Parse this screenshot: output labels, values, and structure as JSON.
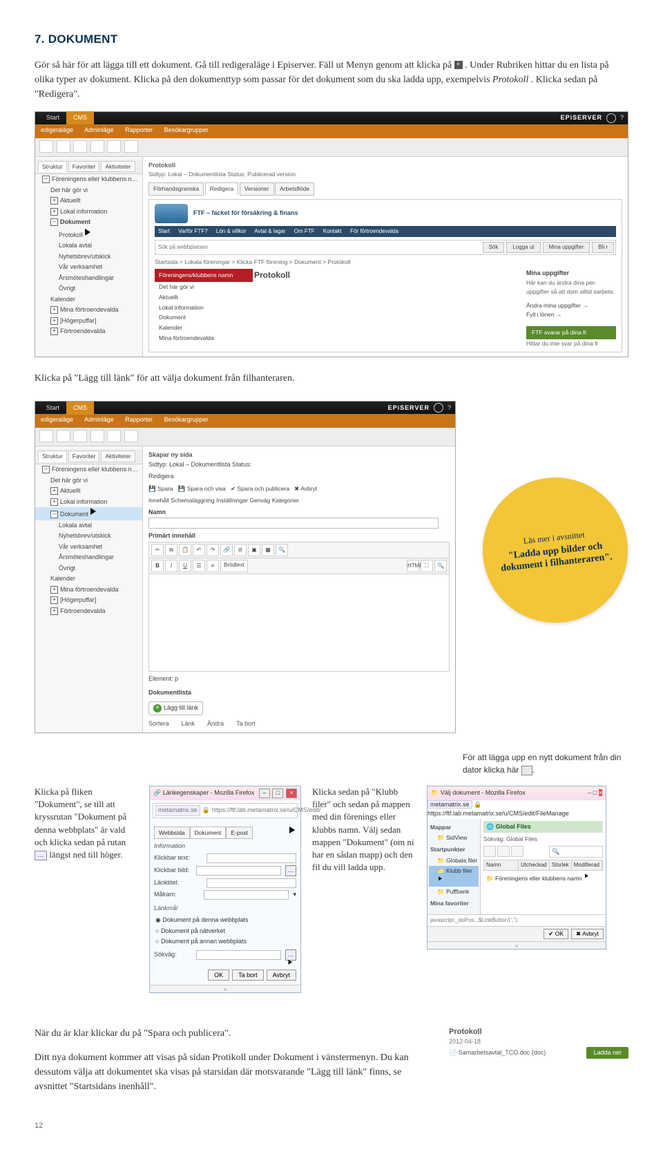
{
  "heading": "7. DOKUMENT",
  "intro": {
    "p1a": "Gör så här för att lägga till ett dokument. Gå till redigeraläge i Episerver. Fäll ut Menyn genom att klicka på ",
    "p1b": ". Under Rubriken hittar du en lista på olika typer av dokument. Klicka på den dokumenttyp som passar för det dokument som du ska ladda upp, exempelvis ",
    "p1c": "Protokoll",
    "p1d": ". Klicka sedan på \"Redigera\"."
  },
  "shot1": {
    "start": "Start",
    "cms": "CMS",
    "brand": "EPiSERVER",
    "subnav": [
      "edigeraläge",
      "Adminläge",
      "Rapporter",
      "Besökargrupper"
    ],
    "tabs": [
      "Struktur",
      "Favoriter",
      "Aktiviteter"
    ],
    "tree": [
      {
        "lv": 1,
        "t": "Föreningens eller klubbens namn"
      },
      {
        "lv": 2,
        "t": "Det här gör vi"
      },
      {
        "lv": 2,
        "t": "Aktuellt"
      },
      {
        "lv": 2,
        "t": "Lokal information"
      },
      {
        "lv": 2,
        "t": "Dokument",
        "open": true
      },
      {
        "lv": 3,
        "t": "Protokoll"
      },
      {
        "lv": 3,
        "t": "Lokala avtal"
      },
      {
        "lv": 3,
        "t": "Nyhetsbrev/utskick"
      },
      {
        "lv": 3,
        "t": "Vår verksamhet"
      },
      {
        "lv": 3,
        "t": "Årsmöteshandlingar"
      },
      {
        "lv": 3,
        "t": "Övrigt"
      },
      {
        "lv": 2,
        "t": "Kalender"
      },
      {
        "lv": 2,
        "t": "Mina förtroendevalda"
      },
      {
        "lv": 2,
        "t": "[Högerpuffar]"
      },
      {
        "lv": 2,
        "t": "Förtroendevalda"
      }
    ],
    "pageTitle": "Protokoll",
    "pagePath": "Sidtyp: Lokal – Dokumentlista   Status: Publicerad version",
    "viewtabs": [
      "Förhandsgranska",
      "Redigera",
      "Versioner",
      "Arbetsflöde"
    ],
    "siteNav": [
      "Start",
      "Varför FTF?",
      "Lön & villkor",
      "Avtal & lagar",
      "Om FTF",
      "Kontakt",
      "För förtroendevalda"
    ],
    "searchPlaceholder": "Sök på webbplatsen",
    "searchBtn": "Sök",
    "siteBtns": [
      "Logga ut",
      "Mina uppgifter",
      "Bli r"
    ],
    "breadcrumb": "Startsida > Lokala föreningar > Klicka FTF förening > Dokument > Protokoll",
    "redHeader": "Föreningens/klubbens namn",
    "sideItems": [
      "Det här gör vi",
      "Aktuellt",
      "Lokal information",
      "Dokument",
      "Kalender",
      "Mina förtroendevalda"
    ],
    "mainH": "Protokoll",
    "rightH": "Mina uppgifter",
    "rightTxt": "Här kan du ändra dina per­uppgifter så att dom alltid s­arbete.",
    "rightLink": "Ändra mina uppgifter →",
    "rightLink2": "Fyll i lönen →",
    "greenBtn": "FTF svarar på dina fr",
    "greenSub": "Hittar du inte svar på dina fr",
    "logoText": "FTF – facket för försäkring & finans"
  },
  "mid_caption": "Klicka på \"Lägg till länk\" för att välja dokument från filhanteraren.",
  "shot2": {
    "start": "Start",
    "cms": "CMS",
    "brand": "EPiSERVER",
    "subnav": [
      "edigeraläge",
      "Adminläge",
      "Rapporter",
      "Besökargrupper"
    ],
    "tabs": [
      "Struktur",
      "Favoriter",
      "Aktiviteter"
    ],
    "tree": [
      {
        "lv": 1,
        "t": "Föreningens eller klubbens namn"
      },
      {
        "lv": 2,
        "t": "Det här gör vi"
      },
      {
        "lv": 2,
        "t": "Aktuellt"
      },
      {
        "lv": 2,
        "t": "Lokal information"
      },
      {
        "lv": 2,
        "t": "Dokument",
        "sel": true
      },
      {
        "lv": 3,
        "t": "Lokala avtal"
      },
      {
        "lv": 3,
        "t": "Nyhetsbrev/utskick"
      },
      {
        "lv": 3,
        "t": "Vår verksamhet"
      },
      {
        "lv": 3,
        "t": "Årsmöteshandlingar"
      },
      {
        "lv": 3,
        "t": "Övrigt"
      },
      {
        "lv": 2,
        "t": "Kalender"
      },
      {
        "lv": 2,
        "t": "Mina förtroendevalda"
      },
      {
        "lv": 2,
        "t": "[Högerpuffar]"
      },
      {
        "lv": 2,
        "t": "Förtroendevalda"
      }
    ],
    "newPage": "Skapar ny sida",
    "newPageSub": "Sidtyp: Lokal – Dokumentlista   Status:",
    "editTab": "Redigera",
    "saveBtns": [
      "Spara",
      "Spara och visa",
      "Spara och publicera",
      "Avbryt"
    ],
    "innerTabs": [
      "Innehåll",
      "Schemaläggning",
      "Inställningar",
      "Genväg",
      "Kategorier"
    ],
    "name": "Namn",
    "primary": "Primärt innehåll",
    "rtSel": [
      "Brödtext",
      "HTML"
    ],
    "elLabel": "Element: p",
    "docList": "Dokumentlista",
    "addLink": "Lägg till länk",
    "actions": [
      "Sortera",
      "Länk",
      "Ändra",
      "Ta bort"
    ]
  },
  "badge": {
    "l1": "Läs mer i avsnittet",
    "l2": "\"Ladda upp bilder och dokument i filhanteraren\"."
  },
  "sideNote": "För att lägga upp en nytt dokument från din dator klicka här ",
  "col1": "Klicka på fliken \"Dokument\", se till att kryssrutan \"Dokument på denna webbplats\" är vald och klicka sedan på rutan ",
  "col1b": " längst ned till höger.",
  "dialog1": {
    "title": "Länkegenskaper - Mozilla Firefox",
    "url": "https://ftf.lab.metamatrix.se/u/CMS/edit/",
    "tabs": [
      "Webbsida",
      "Dokument",
      "E-post"
    ],
    "section": "Information",
    "fields": [
      "Klickbar text:",
      "Klickbar bild:",
      "Länktitel:",
      "Målram:"
    ],
    "section2": "Länkmål",
    "radios": [
      "Dokument på denna webbplats",
      "Dokument på nätverket",
      "Dokument på annan webbplats"
    ],
    "pathLbl": "Sökväg:",
    "buttons": [
      "OK",
      "Ta bort",
      "Avbryt"
    ]
  },
  "col3": "Klicka sedan på \"Klubb filer\" och sedan på mappen med din förenings eller klubbs namn. Välj sedan mappen \"Dokument\" (om ni har en sådan mapp) och den fil du vill ladda upp.",
  "dialog2": {
    "title": "Välj dokument - Mozilla Firefox",
    "url": "https://ftf.lab.metamatrix.se/u/CMS/edit/FileManage",
    "sideH1": "Mappar",
    "globals": "Global Files",
    "pathLabel": "Sökväg: Global Files",
    "sideH2": "Startpunkter",
    "items": [
      "Globala filer",
      "Klubb filer",
      "Puffbank"
    ],
    "sideH3": "Mina favoriter",
    "headers": [
      "Namn",
      "Utcheckad",
      "Storlek",
      "Modifierad"
    ],
    "folder": "Föreningens eller klubbens namn",
    "footer": "javascript:_doPos...$LinkButton1','')",
    "buttons": [
      "OK",
      "Avbryt"
    ]
  },
  "final1": "När du är klar klickar du på \"Spara och publicera\".",
  "final2": "Ditt nya dokument kommer att visas på sidan Protikoll under Doku­ment i vänstermenyn. Du kan dessutom välja att dokumentet ska visas på starsidan där motsvarande \"Lägg till länk\" finns, se avsnittet \"Startsidans inenhåll\".",
  "result": {
    "title": "Protokoll",
    "date": "2012-04-18",
    "file": "Samarbetsavtal_TCO.doc (doc)",
    "dl": "Ladda ner"
  },
  "pagenum": "12"
}
